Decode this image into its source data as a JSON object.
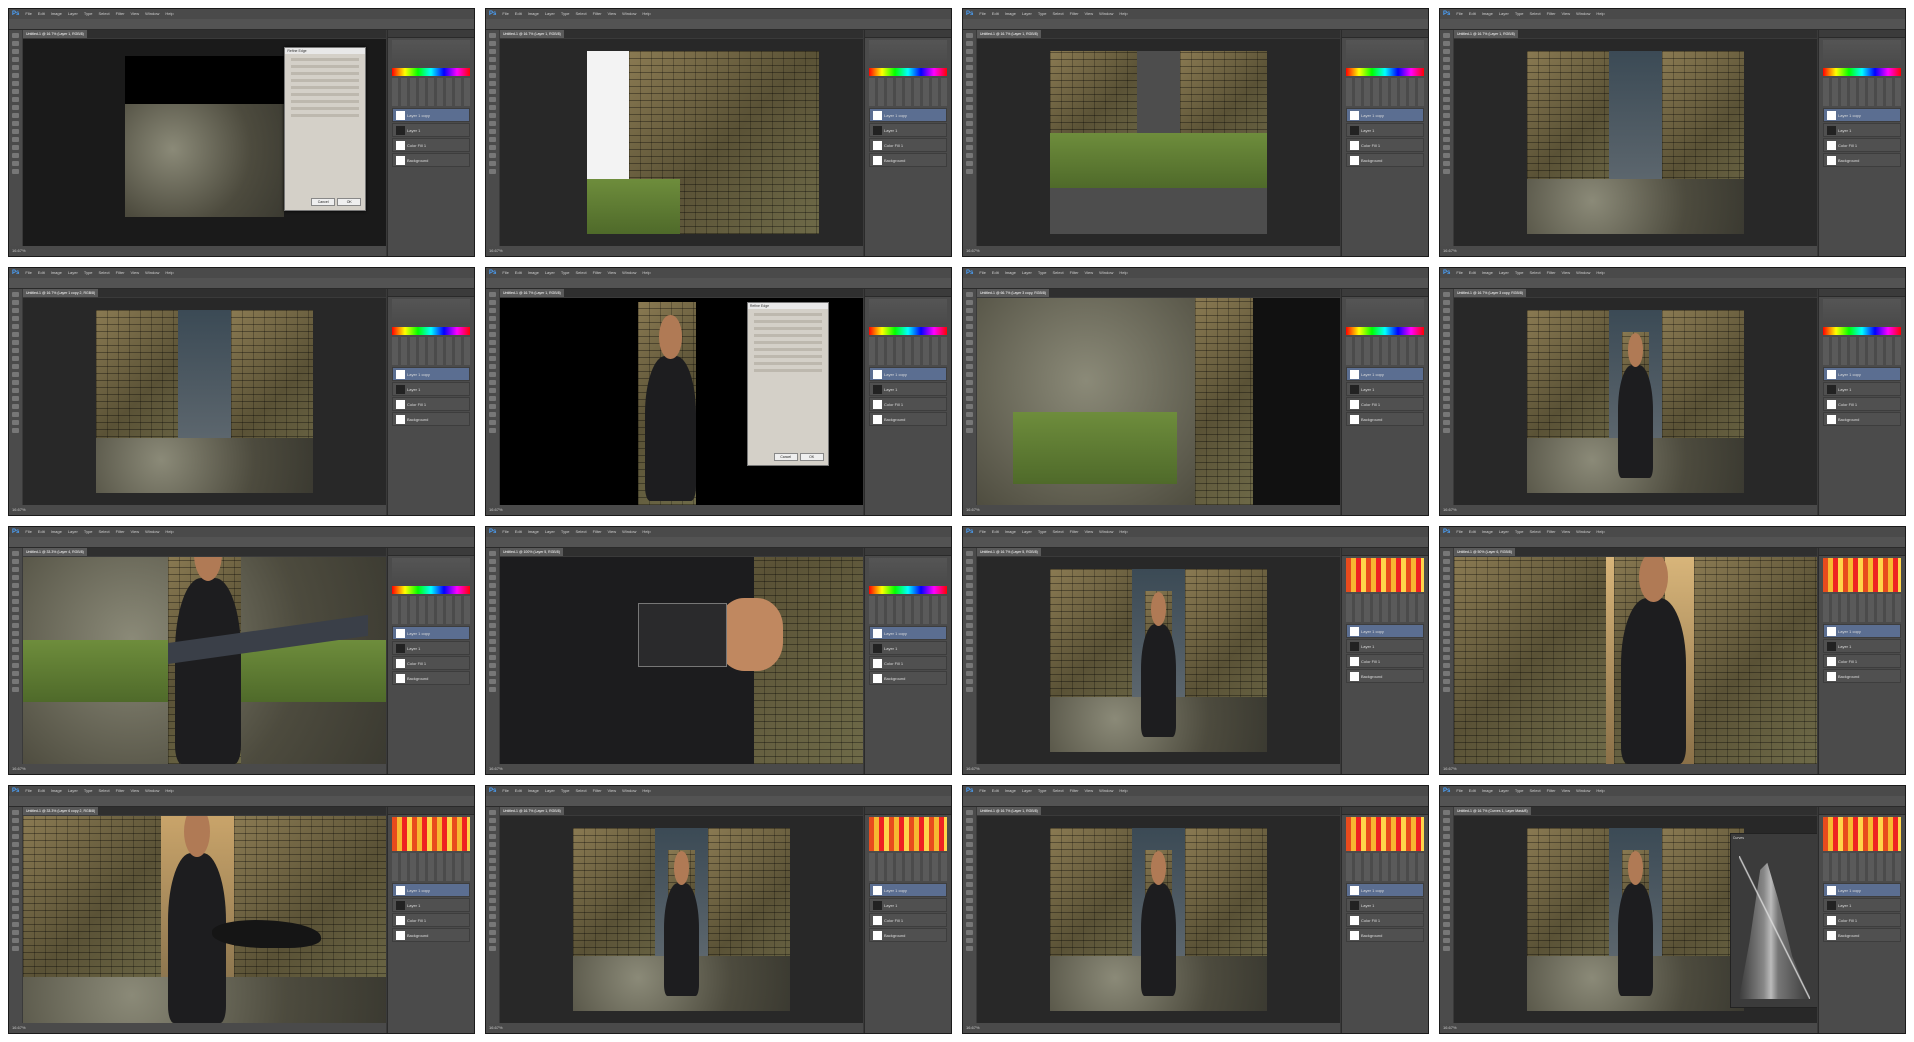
{
  "app": {
    "logo": "Ps",
    "menu": [
      "File",
      "Edit",
      "Image",
      "Layer",
      "Type",
      "Select",
      "Filter",
      "View",
      "Window",
      "Help"
    ],
    "status_zoom": "16.67%"
  },
  "dialogs": {
    "refine_edge": {
      "title": "Refine Edge",
      "ok": "OK",
      "cancel": "Cancel"
    },
    "curves": {
      "title": "Curves"
    }
  },
  "layers": {
    "layer1": "Layer 1",
    "layer1copy": "Layer 1 copy",
    "colorfill": "Color Fill 1",
    "background": "Background"
  },
  "frames": [
    {
      "tab": "Untitled-1 @ 16.7% (Layer 1, RGB/8)",
      "scene": "refine-rock"
    },
    {
      "tab": "Untitled-1 @ 16.7% (Layer 1, RGB/8)",
      "scene": "wall-left"
    },
    {
      "tab": "Untitled-1 @ 16.7% (Layer 1, RGB/8)",
      "scene": "wall-mirror"
    },
    {
      "tab": "Untitled-1 @ 16.7% (Layer 1, RGB/8)",
      "scene": "wall-sky"
    },
    {
      "tab": "Untitled-1 @ 16.7% (Layer 1 copy 2, RGB/8)",
      "scene": "wall-sky"
    },
    {
      "tab": "Untitled-1 @ 16.7% (Layer 1, RGB/8)",
      "scene": "refine-woman"
    },
    {
      "tab": "Untitled-1 @ 66.7% (Layer 3 copy, RGB/8)",
      "scene": "rocks-zoom"
    },
    {
      "tab": "Untitled-1 @ 16.7% (Layer 3 copy, RGB/8)",
      "scene": "wall-woman"
    },
    {
      "tab": "Untitled-1 @ 33.3% (Layer 4, RGB/8)",
      "scene": "woman-scarf"
    },
    {
      "tab": "Untitled-1 @ 100% (Layer 5, RGB/8)",
      "scene": "wrist-zoom"
    },
    {
      "tab": "Untitled-1 @ 16.7% (Layer 5, RGB/8)",
      "scene": "wall-woman"
    },
    {
      "tab": "Untitled-1 @ 50% (Layer 6, RGB/8)",
      "scene": "woman-warm"
    },
    {
      "tab": "Untitled-1 @ 33.3% (Layer 6 copy 2, RGB/8)",
      "scene": "woman-scarf-warm"
    },
    {
      "tab": "Untitled-1 @ 16.7% (Layer 1, RGB/8)",
      "scene": "wall-woman"
    },
    {
      "tab": "Untitled-1 @ 16.7% (Layer 1, RGB/8)",
      "scene": "wall-woman"
    },
    {
      "tab": "Untitled-1 @ 16.7% (Curves 1, Layer Mask/8)",
      "scene": "curves"
    }
  ]
}
